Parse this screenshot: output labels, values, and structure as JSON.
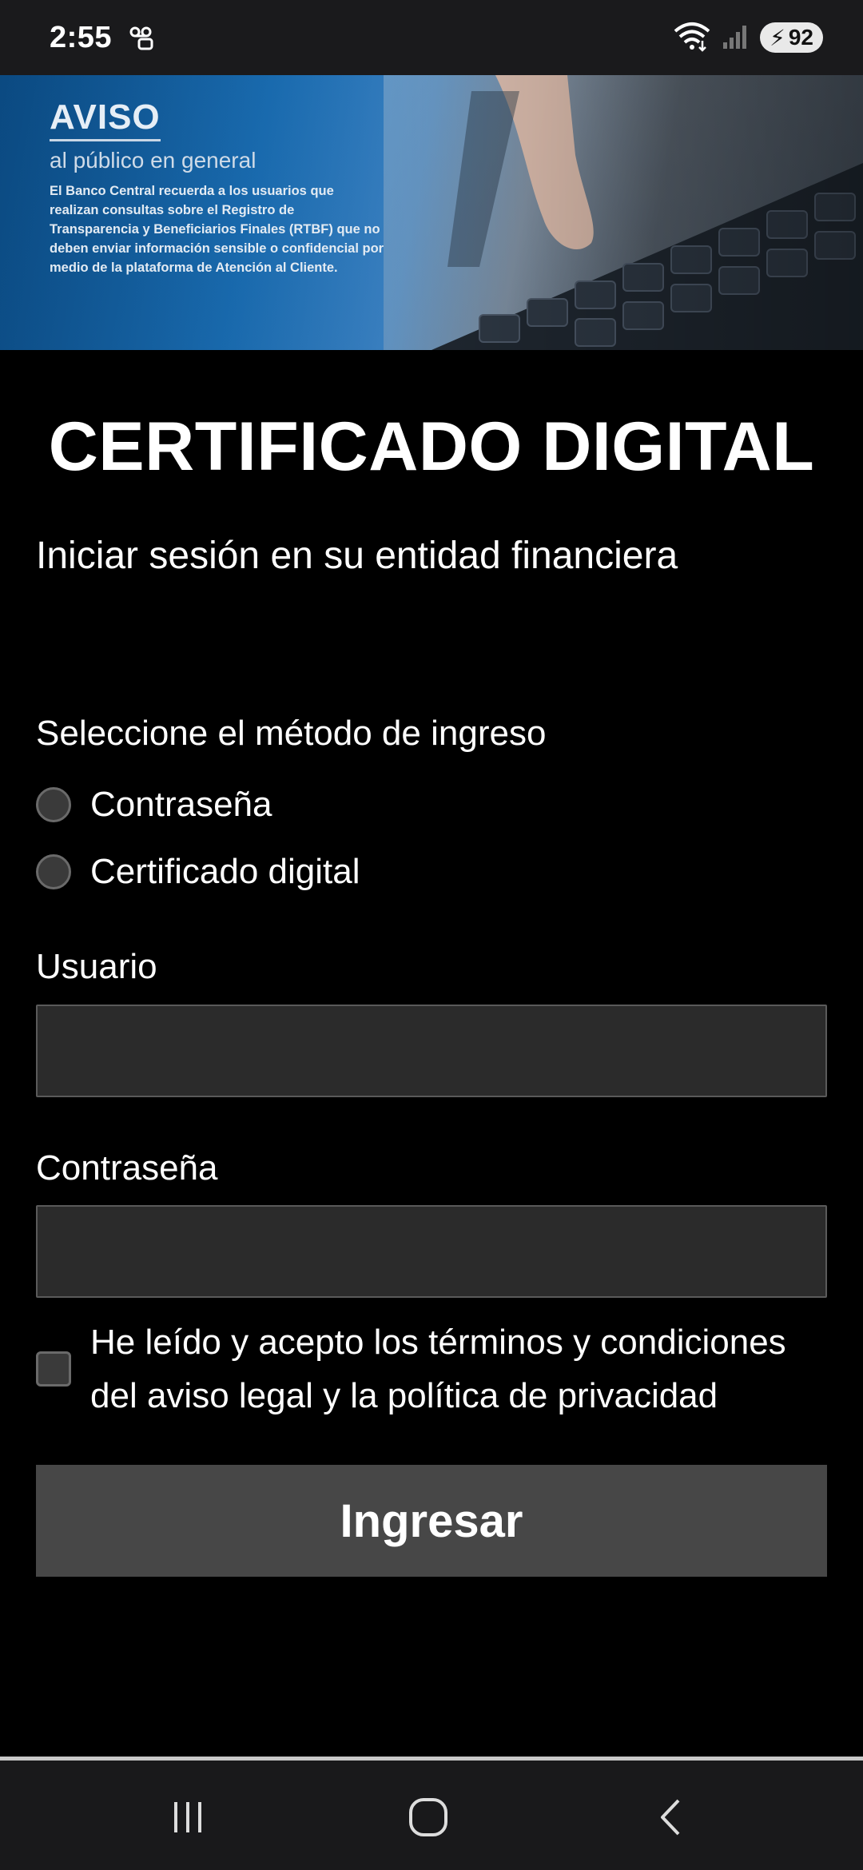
{
  "status_bar": {
    "time": "2:55",
    "battery_level": "92",
    "icons": [
      "voicemail-icon",
      "wifi-icon",
      "signal-icon",
      "battery-icon"
    ]
  },
  "banner": {
    "title": "AVISO",
    "subtitle": "al público en general",
    "body": "El Banco Central recuerda a los usuarios que realizan consultas sobre el Registro de Transparencia y Beneficiarios Finales (RTBF) que no deben enviar información sensible o confidencial por medio de la plataforma de Atención al Cliente."
  },
  "main": {
    "title": "CERTIFICADO DIGITAL",
    "subtitle": "Iniciar sesión en su entidad financiera",
    "method_label": "Seleccione el método de ingreso",
    "methods": [
      {
        "label": "Contraseña",
        "selected": false
      },
      {
        "label": "Certificado digital",
        "selected": false
      }
    ],
    "user_label": "Usuario",
    "user_value": "",
    "password_label": "Contraseña",
    "password_value": "",
    "terms_checked": false,
    "terms_line1": "He leído y acepto los términos y condiciones",
    "terms_line2": "del aviso legal y la política de privacidad",
    "submit_label": "Ingresar"
  },
  "nav_bar": {
    "icons": [
      "recent-apps-icon",
      "home-icon",
      "back-icon"
    ]
  },
  "colors": {
    "background": "#000000",
    "input_bg": "#2b2b2b",
    "button_bg": "#474747"
  }
}
